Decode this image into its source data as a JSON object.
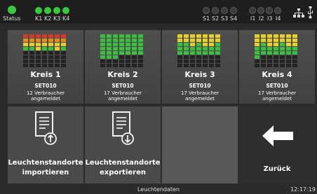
{
  "topbar": {
    "status_label": "Status",
    "k_labels": [
      "K1",
      "K2",
      "K3",
      "K4"
    ],
    "s_labels": [
      "S1",
      "S2",
      "S3",
      "S4"
    ],
    "i_labels": [
      "I1",
      "I2",
      "I3",
      "I4"
    ],
    "status_led": "on",
    "k_leds": [
      "on",
      "on",
      "on",
      "on"
    ],
    "s_leds": [
      "off",
      "off",
      "off",
      "off"
    ],
    "i_leds": [
      "off",
      "off",
      "off",
      "off"
    ],
    "icons": [
      "network-icon",
      "usb-icon"
    ]
  },
  "colors": {
    "led_on": "#38c93e",
    "green": "#3bbf3f",
    "yellow": "#e6cf28",
    "orange": "#e68a1c",
    "red": "#d63b2a",
    "unlit": "#232323",
    "tile": "#4a4a4a",
    "tile_empty": "#595959",
    "tile_back": "#2e2e2e"
  },
  "circuits": [
    {
      "name": "Kreis 1",
      "set": "SET010",
      "count_line1": "12  Verbraucher",
      "count_line2": "angemeldet",
      "matrix": [
        [
          "red",
          "red",
          "red",
          "red",
          "red",
          "red",
          "red"
        ],
        [
          "orange",
          "orange",
          "orange",
          "orange",
          "orange",
          "orange",
          "orange"
        ],
        [
          "yellow",
          "yellow",
          "yellow",
          "yellow",
          "yellow",
          "yellow",
          "yellow"
        ],
        [
          "green",
          "green",
          "yellow",
          "green",
          "green",
          "yellow",
          "green"
        ],
        [
          "unlit",
          "unlit",
          "unlit",
          "unlit",
          "unlit",
          "unlit",
          "unlit"
        ],
        [
          "unlit",
          "unlit",
          "unlit",
          "unlit",
          "unlit",
          "unlit",
          "unlit"
        ],
        [
          "unlit",
          "unlit",
          "unlit",
          "unlit",
          "unlit",
          "unlit",
          "unlit"
        ],
        [
          "unlit",
          "unlit",
          "unlit",
          "unlit",
          "unlit",
          "unlit",
          "unlit"
        ]
      ]
    },
    {
      "name": "Kreis 2",
      "set": "SET010",
      "count_line1": "17  Verbraucher",
      "count_line2": "angemeldet",
      "matrix": [
        [
          "green",
          "green",
          "green",
          "green",
          "green",
          "green",
          "green"
        ],
        [
          "green",
          "green",
          "green",
          "green",
          "green",
          "green",
          "green"
        ],
        [
          "green",
          "green",
          "green",
          "green",
          "green",
          "green",
          "green"
        ],
        [
          "green",
          "green",
          "green",
          "green",
          "green",
          "green",
          "green"
        ],
        [
          "green",
          "green",
          "green",
          "green",
          "green",
          "green",
          "green"
        ],
        [
          "green",
          "green",
          "green",
          "unlit",
          "unlit",
          "unlit",
          "unlit"
        ],
        [
          "unlit",
          "unlit",
          "unlit",
          "unlit",
          "unlit",
          "unlit",
          "unlit"
        ],
        [
          "unlit",
          "unlit",
          "unlit",
          "unlit",
          "unlit",
          "unlit",
          "unlit"
        ]
      ]
    },
    {
      "name": "Kreis 3",
      "set": "SET010",
      "count_line1": "17  Verbraucher",
      "count_line2": "angemeldet",
      "matrix": [
        [
          "yellow",
          "yellow",
          "yellow",
          "yellow",
          "yellow",
          "yellow",
          "yellow"
        ],
        [
          "yellow",
          "yellow",
          "yellow",
          "yellow",
          "yellow",
          "yellow",
          "yellow"
        ],
        [
          "green",
          "green",
          "yellow",
          "green",
          "yellow",
          "yellow",
          "green"
        ],
        [
          "green",
          "green",
          "green",
          "green",
          "green",
          "green",
          "green"
        ],
        [
          "green",
          "green",
          "green",
          "green",
          "green",
          "green",
          "green"
        ],
        [
          "unlit",
          "unlit",
          "unlit",
          "unlit",
          "unlit",
          "unlit",
          "unlit"
        ],
        [
          "unlit",
          "unlit",
          "unlit",
          "unlit",
          "unlit",
          "unlit",
          "unlit"
        ],
        [
          "unlit",
          "unlit",
          "unlit",
          "unlit",
          "unlit",
          "unlit",
          "unlit"
        ]
      ]
    },
    {
      "name": "Kreis 4",
      "set": "SET010",
      "count_line1": "17  Verbraucher",
      "count_line2": "angemeldet",
      "matrix": [
        [
          "yellow",
          "yellow",
          "yellow",
          "yellow",
          "yellow",
          "yellow",
          "yellow"
        ],
        [
          "yellow",
          "yellow",
          "yellow",
          "yellow",
          "yellow",
          "yellow",
          "yellow"
        ],
        [
          "yellow",
          "green",
          "yellow",
          "yellow",
          "green",
          "yellow",
          "yellow"
        ],
        [
          "green",
          "green",
          "green",
          "green",
          "green",
          "green",
          "green"
        ],
        [
          "green",
          "green",
          "green",
          "green",
          "green",
          "green",
          "green"
        ],
        [
          "green",
          "unlit",
          "unlit",
          "unlit",
          "unlit",
          "unlit",
          "unlit"
        ],
        [
          "unlit",
          "unlit",
          "unlit",
          "unlit",
          "unlit",
          "unlit",
          "unlit"
        ],
        [
          "unlit",
          "unlit",
          "unlit",
          "unlit",
          "unlit",
          "unlit",
          "unlit"
        ]
      ]
    }
  ],
  "actions": {
    "import_line1": "Leuchtenstandorte",
    "import_line2": "importieren",
    "export_line1": "Leuchtenstandorte",
    "export_line2": "exportieren",
    "back_label": "Zurück",
    "import_icon": "document-import-icon",
    "export_icon": "document-export-icon",
    "back_icon": "arrow-left-icon"
  },
  "footer": {
    "title": "Leuchtendaten",
    "time": "12:17:19"
  }
}
